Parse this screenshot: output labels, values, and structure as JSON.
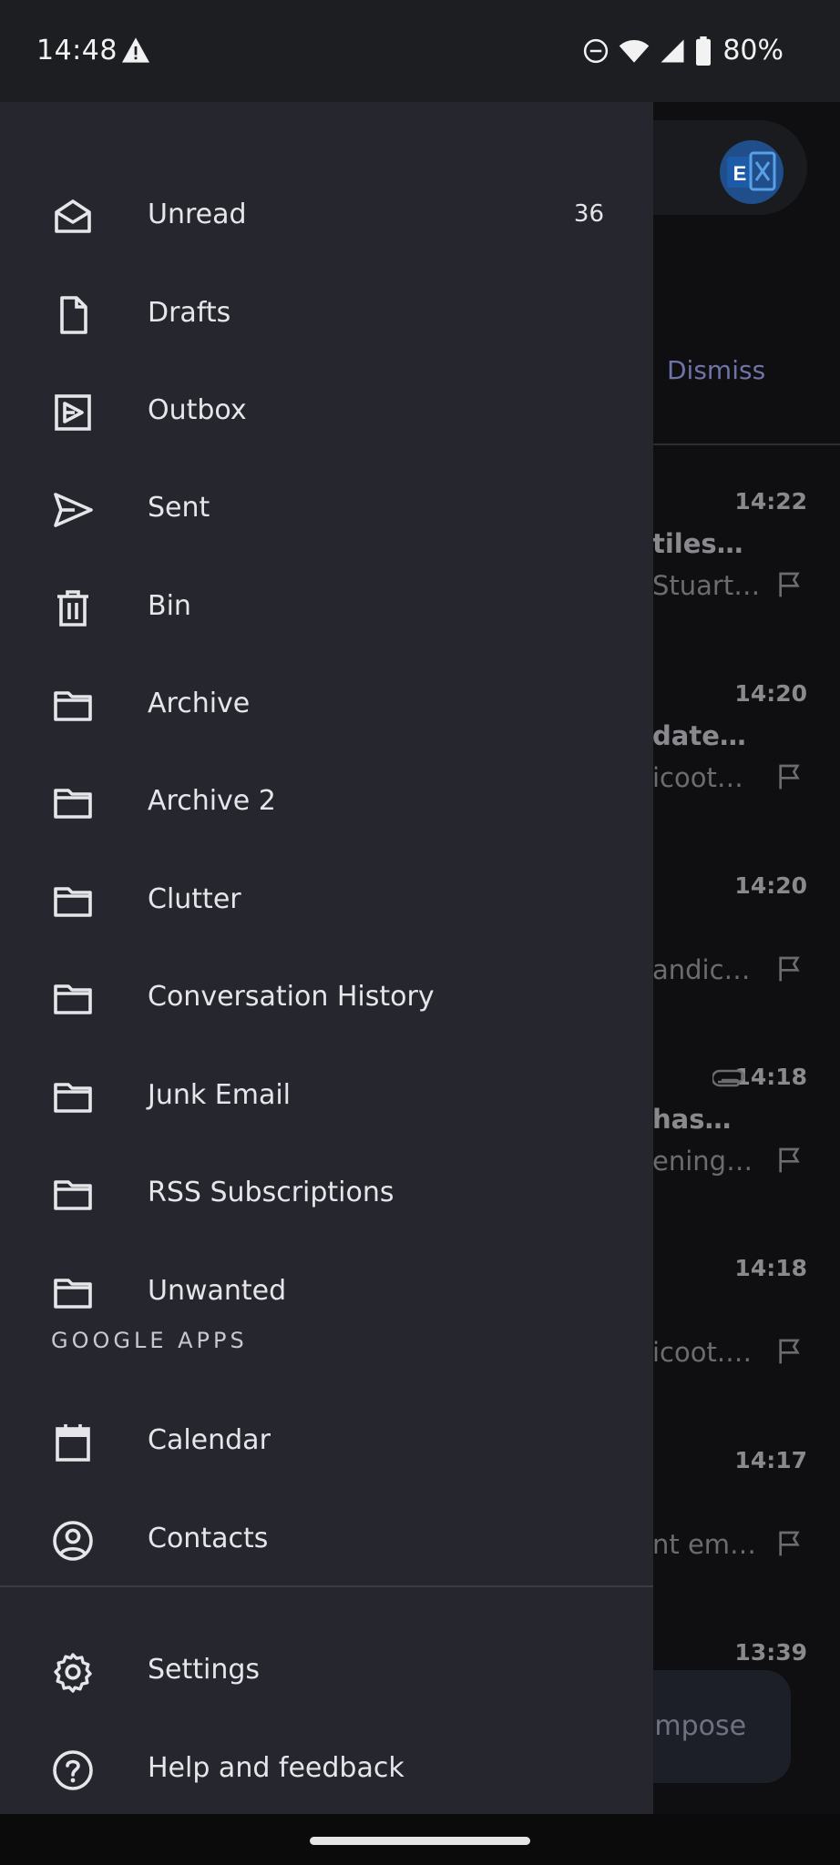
{
  "status_bar": {
    "time": "14:48",
    "battery": "80%",
    "icons": [
      "warning-icon",
      "do-not-disturb-icon",
      "wifi-icon",
      "signal-icon",
      "battery-icon"
    ]
  },
  "drawer": {
    "folders": [
      {
        "label": "Unread",
        "count": "36",
        "icon": "envelope-open-icon"
      },
      {
        "label": "Drafts",
        "icon": "draft-file-icon"
      },
      {
        "label": "Outbox",
        "icon": "outbox-icon"
      },
      {
        "label": "Sent",
        "icon": "send-icon"
      },
      {
        "label": "Bin",
        "icon": "trash-icon"
      },
      {
        "label": "Archive",
        "icon": "folder-icon"
      },
      {
        "label": "Archive 2",
        "icon": "folder-icon"
      },
      {
        "label": "Clutter",
        "icon": "folder-icon"
      },
      {
        "label": "Conversation History",
        "icon": "folder-icon"
      },
      {
        "label": "Junk Email",
        "icon": "folder-icon"
      },
      {
        "label": "RSS Subscriptions",
        "icon": "folder-icon"
      },
      {
        "label": "Unwanted",
        "icon": "folder-icon"
      }
    ],
    "google_apps": {
      "header": "GOOGLE APPS",
      "items": [
        {
          "label": "Calendar",
          "icon": "calendar-icon"
        },
        {
          "label": "Contacts",
          "icon": "contacts-icon"
        }
      ]
    },
    "footer": [
      {
        "label": "Settings",
        "icon": "gear-icon"
      },
      {
        "label": "Help and feedback",
        "icon": "help-icon"
      }
    ]
  },
  "inbox": {
    "dismiss": "Dismiss",
    "compose": "ompose",
    "messages": [
      {
        "time": "14:22",
        "subject": "tiles…",
        "preview": "Stuart…"
      },
      {
        "time": "14:20",
        "subject": "date…",
        "preview": "icoot…"
      },
      {
        "time": "14:20",
        "subject": "",
        "preview": "andic…"
      },
      {
        "time": "14:18",
        "subject": "has…",
        "preview": "ening…",
        "attachment": true
      },
      {
        "time": "14:18",
        "subject": "",
        "preview": "icoot.…"
      },
      {
        "time": "14:17",
        "subject": "",
        "preview": "nt em…"
      },
      {
        "time": "13:39",
        "subject": "",
        "preview": ""
      }
    ]
  },
  "colors": {
    "drawer_bg": "#26272e",
    "status_bar_bg": "#1d1e22",
    "accent_dismiss": "#6e73a8"
  }
}
